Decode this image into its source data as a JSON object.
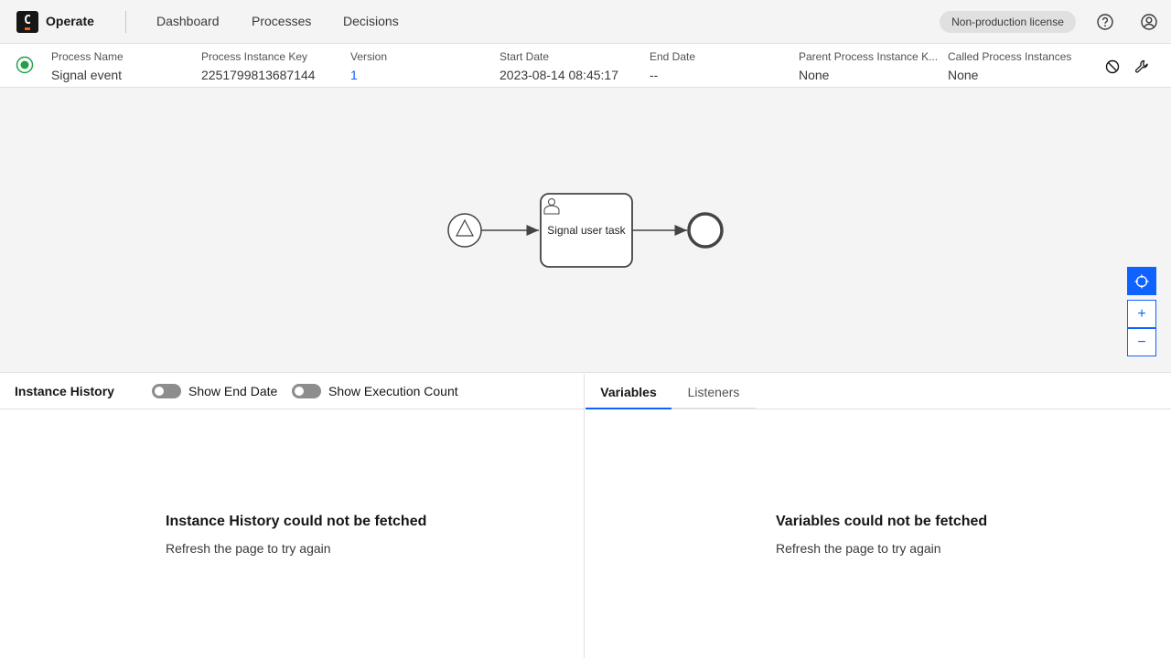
{
  "topbar": {
    "logo_letter": "C",
    "app_name": "Operate",
    "nav": [
      "Dashboard",
      "Processes",
      "Decisions"
    ],
    "license": "Non-production license",
    "help_icon": "help-icon",
    "user_icon": "user-icon"
  },
  "header": {
    "status_icon": "active-status-icon",
    "fields": [
      {
        "label": "Process Name",
        "value": "Signal event"
      },
      {
        "label": "Process Instance Key",
        "value": "2251799813687144"
      },
      {
        "label": "Version",
        "value": "1"
      },
      {
        "label": "Start Date",
        "value": "2023-08-14 08:45:17"
      },
      {
        "label": "End Date",
        "value": "--"
      },
      {
        "label": "Parent Process Instance K...",
        "value": "None"
      },
      {
        "label": "Called Process Instances",
        "value": "None"
      }
    ],
    "cancel_icon": "cancel-icon",
    "modify_icon": "wrench-icon"
  },
  "diagram": {
    "task_label": "Signal user task",
    "reset_icon": "reset-view-icon",
    "zoom_in": "+",
    "zoom_out": "−"
  },
  "instance_history": {
    "title": "Instance History",
    "toggle_end_date": "Show End Date",
    "toggle_exec_count": "Show Execution Count",
    "empty_title": "Instance History could not be fetched",
    "empty_sub": "Refresh the page to try again"
  },
  "variables_panel": {
    "tabs": [
      "Variables",
      "Listeners"
    ],
    "empty_title": "Variables could not be fetched",
    "empty_sub": "Refresh the page to try again"
  },
  "colors": {
    "accent": "#0f62fe",
    "status_active": "#24a148",
    "brand_orange": "#fc5d0d"
  }
}
